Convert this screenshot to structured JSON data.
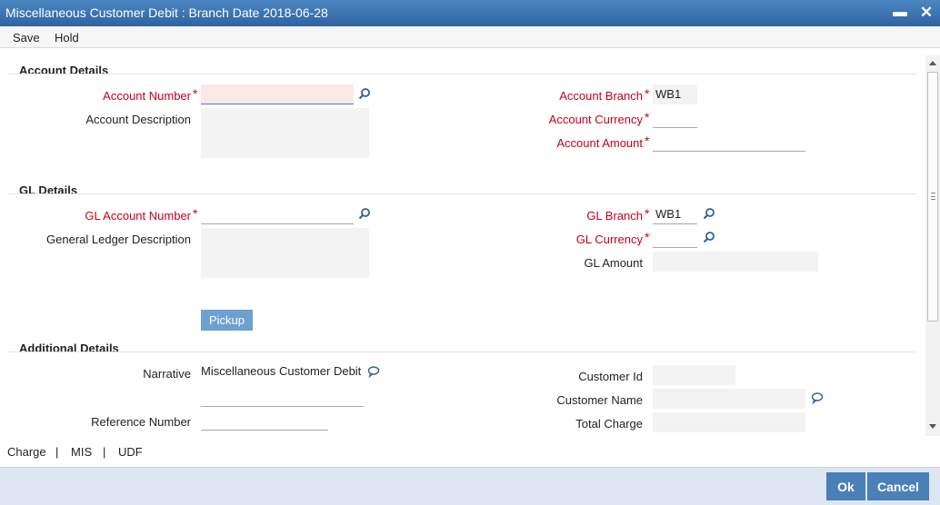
{
  "window": {
    "title": "Miscellaneous Customer Debit : Branch Date 2018-06-28"
  },
  "menu": {
    "save": "Save",
    "hold": "Hold"
  },
  "sections": {
    "account": "Account Details",
    "gl": "GL Details",
    "additional": "Additional Details"
  },
  "account": {
    "number_label": "Account Number",
    "number_value": "",
    "description_label": "Account Description",
    "description_value": "",
    "branch_label": "Account Branch",
    "branch_value": "WB1",
    "currency_label": "Account Currency",
    "currency_value": "",
    "amount_label": "Account Amount",
    "amount_value": ""
  },
  "gl": {
    "number_label": "GL Account Number",
    "number_value": "",
    "description_label": "General Ledger Description",
    "description_value": "",
    "branch_label": "GL Branch",
    "branch_value": "WB1",
    "currency_label": "GL Currency",
    "currency_value": "",
    "amount_label": "GL Amount",
    "amount_value": ""
  },
  "buttons": {
    "pickup": "Pickup",
    "ok": "Ok",
    "cancel": "Cancel"
  },
  "additional": {
    "narrative_label": "Narrative",
    "narrative_value": "Miscellaneous Customer Debit",
    "reference_label": "Reference Number",
    "reference_value": "",
    "customer_id_label": "Customer Id",
    "customer_id_value": "",
    "customer_name_label": "Customer Name",
    "customer_name_value": "",
    "total_charge_label": "Total Charge",
    "total_charge_value": ""
  },
  "tabs": {
    "charge": "Charge",
    "mis": "MIS",
    "udf": "UDF",
    "separator": "|"
  },
  "required_marker": "*",
  "icons": {
    "search": "search-icon",
    "comment": "comment-icon",
    "minimize": "minimize-icon",
    "close": "close-icon"
  },
  "colors": {
    "titlebar": "#3a72b0",
    "required": "#c4001a",
    "button": "#4a7fb8",
    "footer": "#dde6f1"
  }
}
